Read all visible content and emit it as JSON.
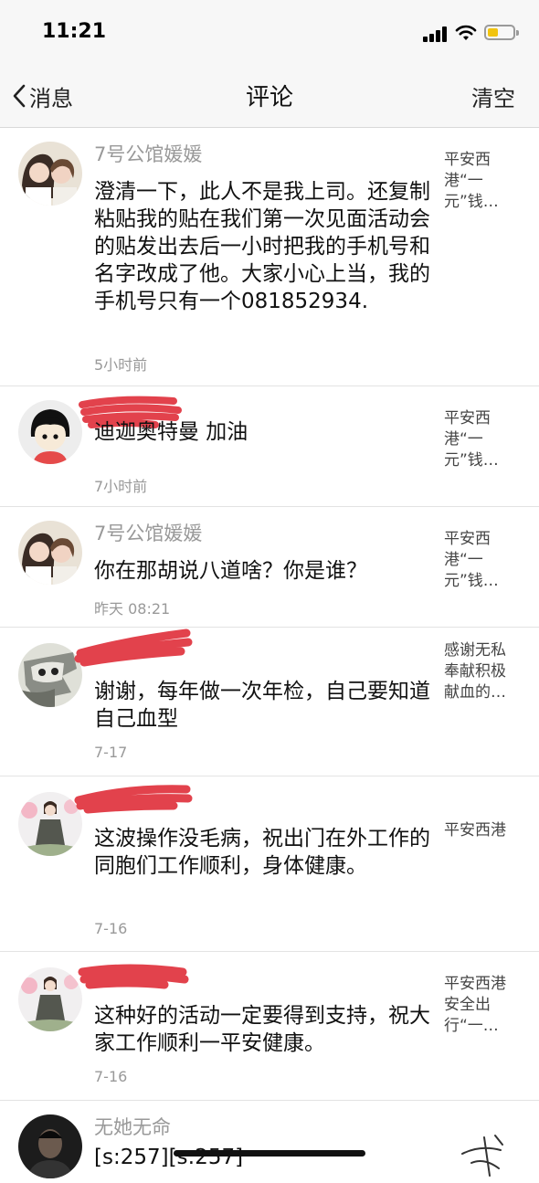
{
  "status_bar": {
    "time": "11:21"
  },
  "nav": {
    "back_label": "消息",
    "title": "评论",
    "clear_label": "清空"
  },
  "comments": [
    {
      "user": "7号公馆媛媛",
      "text": "澄清一下，此人不是我上司。还复制粘贴我的贴在我们第一次见面活动会的贴发出去后一小时把我的手机号和名字改成了他。大家小心上当，我的手机号只有一个081852934.",
      "time": "5小时前",
      "source": "平安西港“一元”钱…"
    },
    {
      "user": "",
      "text": "迪迦奥特曼 加油",
      "time": "7小时前",
      "source": "平安西港“一元”钱…"
    },
    {
      "user": "7号公馆媛媛",
      "text": "你在那胡说八道啥？你是谁？",
      "time": "昨天 08:21",
      "source": "平安西港“一元”钱…"
    },
    {
      "user": "",
      "text": "谢谢，每年做一次年检，自己要知道自己血型",
      "time": "7-17",
      "source": "感谢无私奉献积极献血的…"
    },
    {
      "user": "",
      "text": "这波操作没毛病，祝出门在外工作的同胞们工作顺利，身体健康。",
      "time": "7-16",
      "source": "平安西港"
    },
    {
      "user": "",
      "text": "这种好的活动一定要得到支持，祝大家工作顺利一平安健康。",
      "time": "7-16",
      "source": "平安西港安全出行“一…"
    },
    {
      "user": "无她无命",
      "text": "[s:257][s:257]",
      "time": "",
      "source": ""
    }
  ]
}
